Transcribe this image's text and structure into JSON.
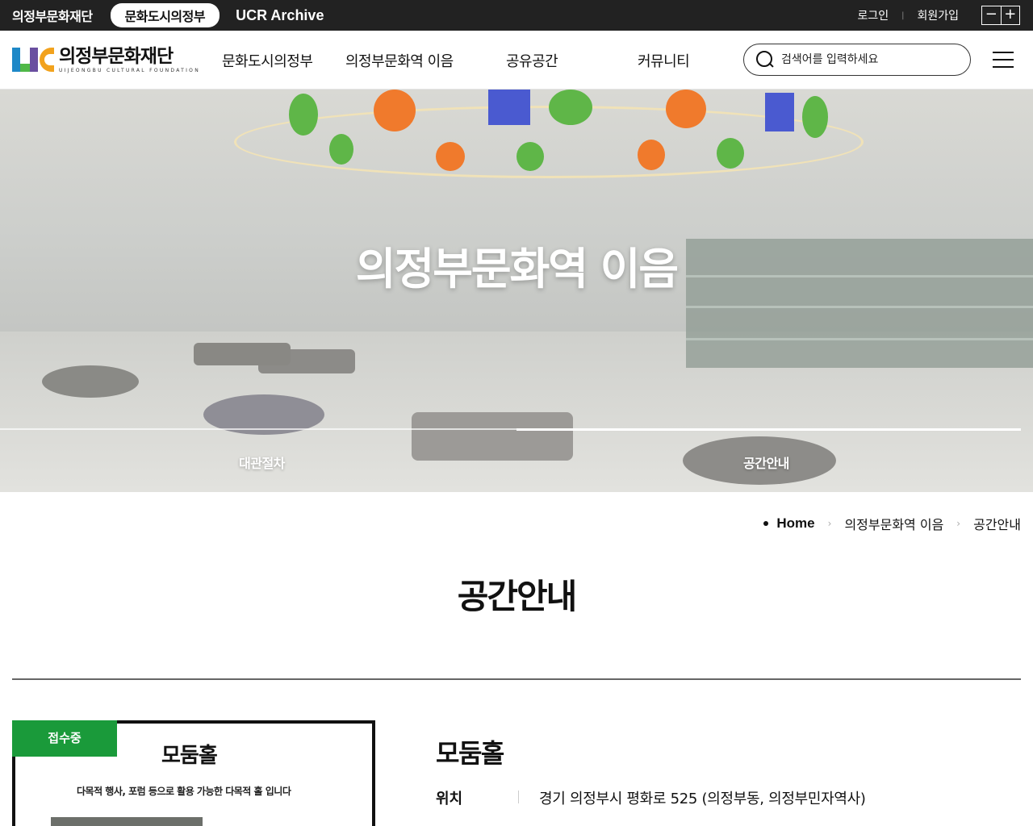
{
  "topbar": {
    "site_name": "의정부문화재단",
    "site_pill": "문화도시의정부",
    "site_archive": "UCR Archive",
    "login": "로그인",
    "signup": "회원가입",
    "zoom_out": "−",
    "zoom_in": "+"
  },
  "header": {
    "logo_ko": "의정부문화재단",
    "logo_en": "UIJEONGBU CULTURAL FOUNDATION",
    "nav": [
      {
        "label": "문화도시의정부"
      },
      {
        "label": "의정부문화역 이음"
      },
      {
        "label": "공유공간"
      },
      {
        "label": "커뮤니티"
      }
    ],
    "search_placeholder": "검색어를 입력하세요"
  },
  "hero": {
    "title": "의정부문화역 이음",
    "tabs": [
      {
        "label": "대관절차",
        "active": false
      },
      {
        "label": "공간안내",
        "active": true
      }
    ]
  },
  "breadcrumb": {
    "home": "Home",
    "level1": "의정부문화역 이음",
    "level2": "공간안내"
  },
  "page_title": "공간안내",
  "space": {
    "status_badge": "접수중",
    "card_title": "모둠홀",
    "card_desc": "다목적 행사, 포럼 등으로 활용 가능한 다목적 홀 입니다",
    "name": "모둠홀",
    "location_label": "위치",
    "location_value": "경기 의정부시 평화로 525 (의정부동, 의정부민자역사)"
  },
  "colors": {
    "topbar_bg": "#222222",
    "badge_green": "#1a9a3a",
    "logo_blue": "#1e88c7",
    "logo_green": "#4fb848",
    "logo_purple": "#6a4fa0",
    "logo_orange": "#f2a21d"
  }
}
